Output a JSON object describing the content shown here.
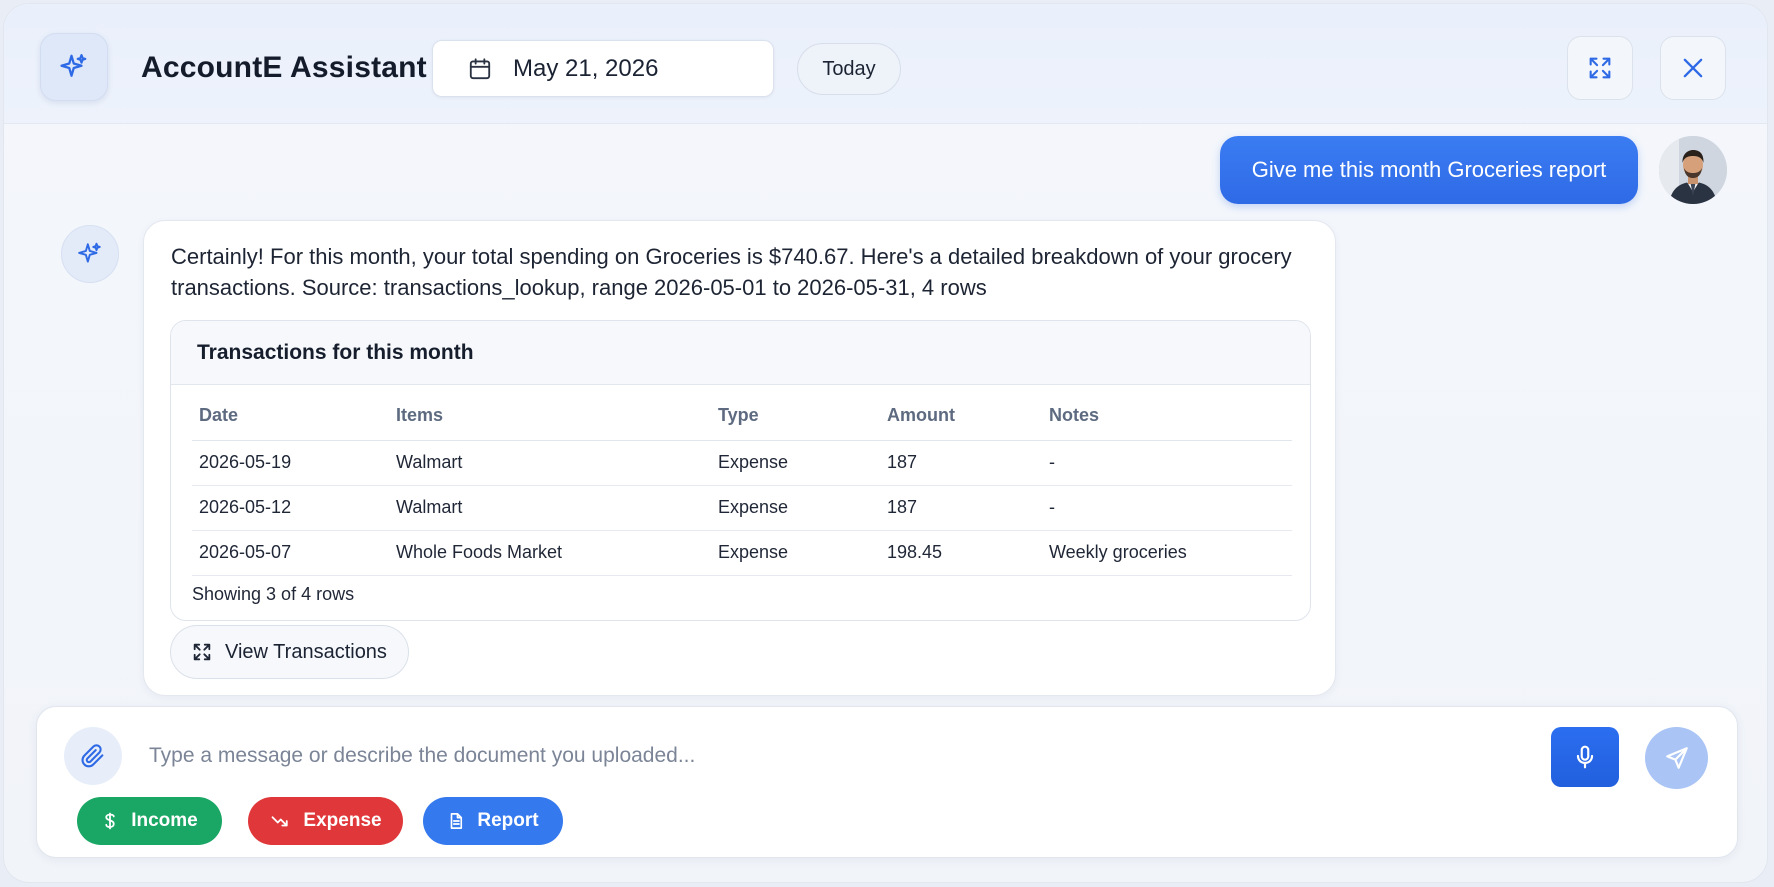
{
  "header": {
    "app_title": "AccountE Assistant",
    "date_value": "May 21, 2026",
    "today_label": "Today",
    "icons": [
      "sparkle-icon",
      "calendar-icon",
      "expand-icon",
      "close-icon"
    ]
  },
  "chat": {
    "user_message": "Give me this month Groceries report",
    "bot_message": "Certainly! For this month, your total spending on Groceries is $740.67. Here's a detailed breakdown of your grocery transactions. Source: transactions_lookup, range 2026-05-01 to 2026-05-31, 4 rows",
    "transactions": {
      "title": "Transactions for this month",
      "columns": [
        "Date",
        "Items",
        "Type",
        "Amount",
        "Notes"
      ],
      "rows": [
        [
          "2026-05-19",
          "Walmart",
          "Expense",
          "187",
          "-"
        ],
        [
          "2026-05-12",
          "Walmart",
          "Expense",
          "187",
          "-"
        ],
        [
          "2026-05-07",
          "Whole Foods Market",
          "Expense",
          "198.45",
          "Weekly groceries"
        ]
      ],
      "footer": "Showing 3 of 4 rows"
    },
    "view_button_label": "View Transactions"
  },
  "composer": {
    "placeholder": "Type a message or describe the document you uploaded...",
    "value": "",
    "chips": {
      "income": "Income",
      "expense": "Expense",
      "report": "Report"
    }
  },
  "colors": {
    "accent": "#2f6ae6",
    "income": "#1aa664",
    "expense": "#e0383a",
    "report": "#3579ee"
  }
}
